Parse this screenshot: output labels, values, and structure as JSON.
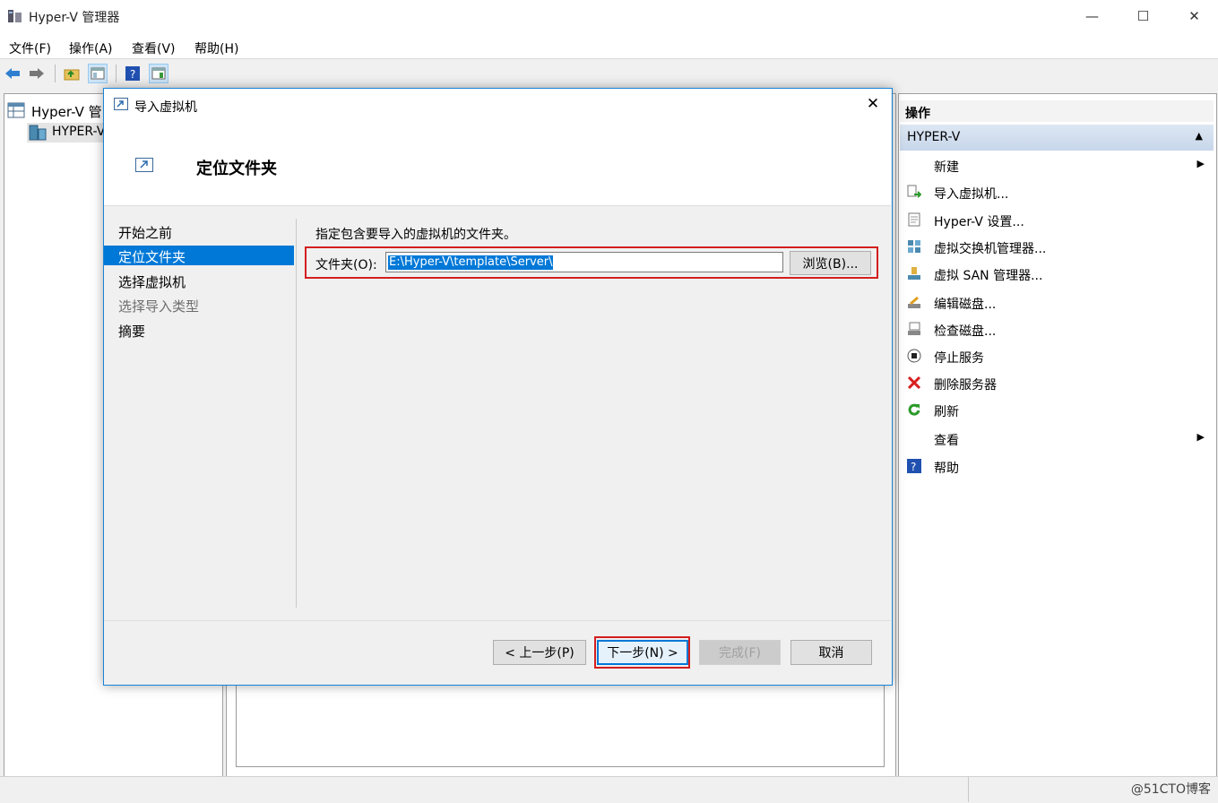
{
  "window": {
    "title": "Hyper-V 管理器",
    "controls": {
      "minimize": "—",
      "maximize": "☐",
      "close": "✕"
    }
  },
  "menu": [
    "文件(F)",
    "操作(A)",
    "查看(V)",
    "帮助(H)"
  ],
  "toolbar": [
    "back-icon",
    "forward-icon",
    "up-folder-icon",
    "console-tree-icon",
    "help-icon",
    "action-pane-icon"
  ],
  "tree": {
    "root": "Hyper-V 管",
    "child": "HYPER-V"
  },
  "actions": {
    "header": "操作",
    "section": "HYPER-V",
    "items": [
      {
        "label": "新建",
        "icon": "",
        "submenu": true
      },
      {
        "label": "导入虚拟机...",
        "icon": "import-vm-icon",
        "submenu": false
      },
      {
        "label": "Hyper-V 设置...",
        "icon": "settings-icon",
        "submenu": false
      },
      {
        "label": "虚拟交换机管理器...",
        "icon": "switch-manager-icon",
        "submenu": false
      },
      {
        "label": "虚拟 SAN 管理器...",
        "icon": "san-manager-icon",
        "submenu": false
      },
      {
        "label": "编辑磁盘...",
        "icon": "edit-disk-icon",
        "submenu": false
      },
      {
        "label": "检查磁盘...",
        "icon": "inspect-disk-icon",
        "submenu": false
      },
      {
        "label": "停止服务",
        "icon": "stop-icon",
        "submenu": false
      },
      {
        "label": "删除服务器",
        "icon": "delete-icon",
        "submenu": false
      },
      {
        "label": "刷新",
        "icon": "refresh-icon",
        "submenu": false
      },
      {
        "label": "查看",
        "icon": "",
        "submenu": true
      },
      {
        "label": "帮助",
        "icon": "help-icon",
        "submenu": false
      }
    ]
  },
  "dialog": {
    "title": "导入虚拟机",
    "heading": "定位文件夹",
    "nav": [
      {
        "label": "开始之前",
        "state": "normal"
      },
      {
        "label": "定位文件夹",
        "state": "active"
      },
      {
        "label": "选择虚拟机",
        "state": "normal"
      },
      {
        "label": "选择导入类型",
        "state": "disabled"
      },
      {
        "label": "摘要",
        "state": "normal"
      }
    ],
    "instruction": "指定包含要导入的虚拟机的文件夹。",
    "folder_label": "文件夹(O):",
    "folder_value": "E:\\Hyper-V\\template\\Server\\",
    "browse": "浏览(B)...",
    "buttons": {
      "prev": "< 上一步(P)",
      "next": "下一步(N) >",
      "finish": "完成(F)",
      "cancel": "取消"
    }
  },
  "watermark": "@51CTO博客"
}
